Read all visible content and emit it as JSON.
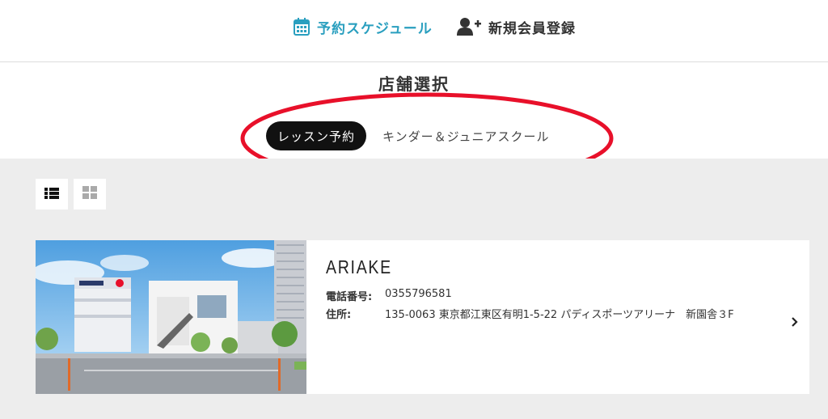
{
  "header": {
    "schedule_label": "予約スケジュール",
    "register_label": "新規会員登録"
  },
  "shop_select": {
    "title": "店舗選択",
    "tabs": [
      {
        "label": "レッスン予約",
        "active": true
      },
      {
        "label": "キンダー＆ジュニアスクール",
        "active": false
      }
    ]
  },
  "view_toggle": {
    "list_icon": "list-icon",
    "grid_icon": "grid-icon"
  },
  "store": {
    "name": "ARIAKE",
    "phone_label": "電話番号:",
    "phone": "0355796581",
    "address_label": "住所:",
    "address": "135-0063 東京都江東区有明1-5-22 パディスポーツアリーナ　新園舎３F"
  },
  "colors": {
    "accent": "#2a9fbf",
    "active_tab_bg": "#111111",
    "annotation": "#e8102a",
    "content_bg": "#ededed"
  }
}
